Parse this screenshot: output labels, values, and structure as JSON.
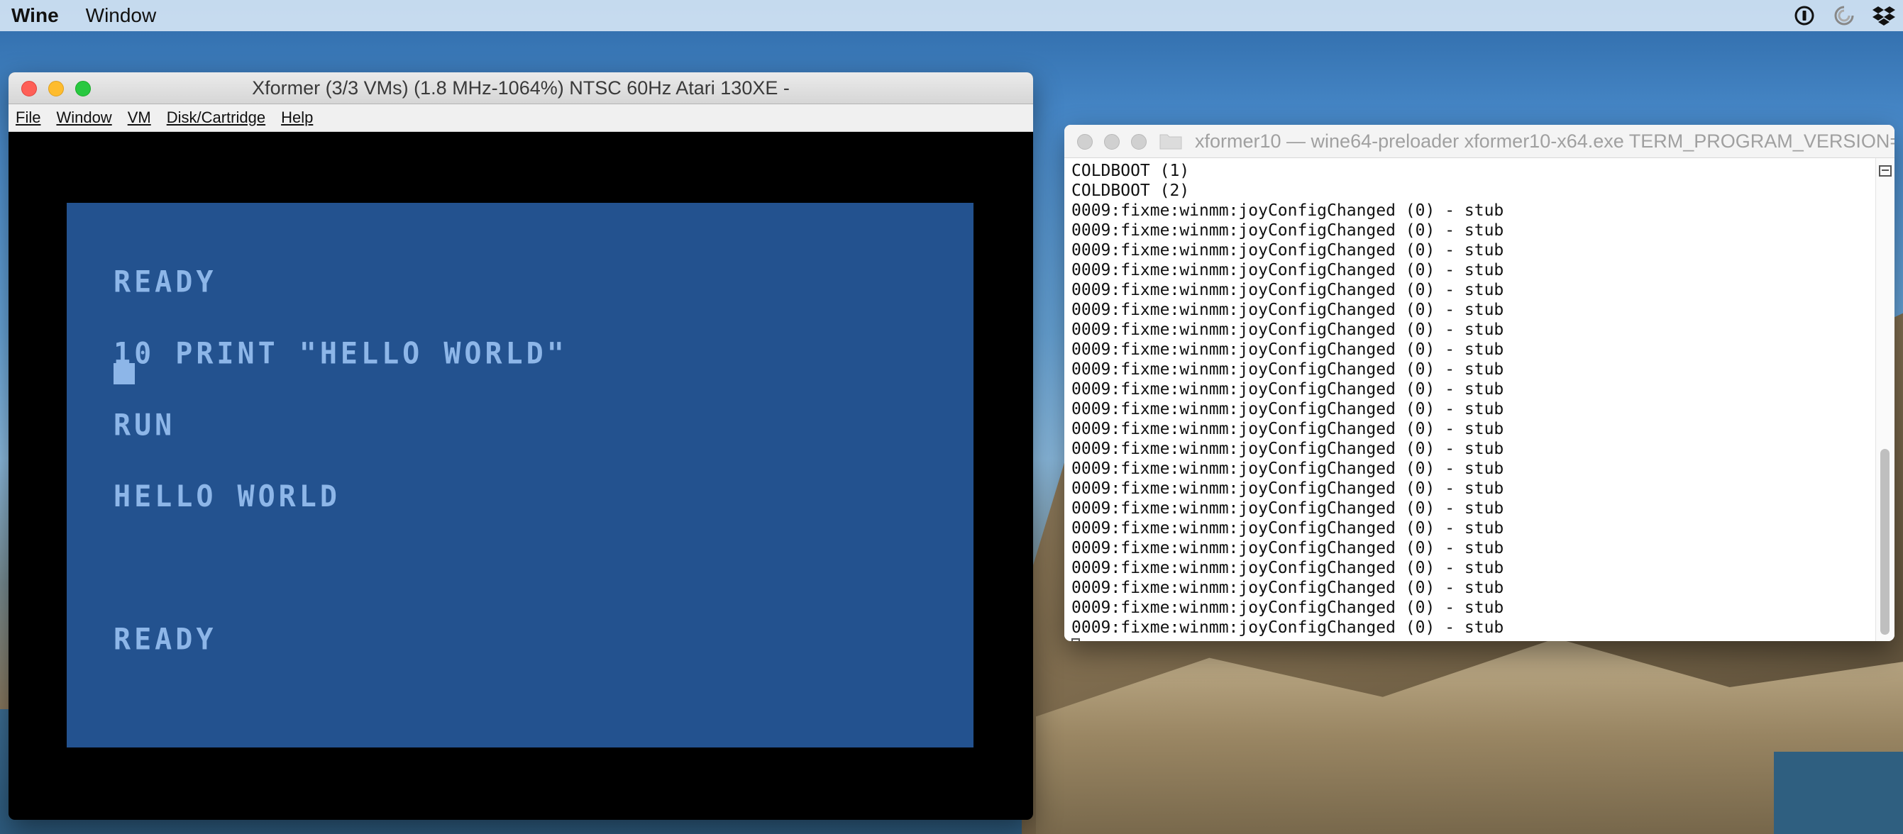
{
  "menubar": {
    "app_name": "Wine",
    "items": [
      "Window"
    ],
    "status_icons": [
      "onepassword-icon",
      "sync-icon",
      "dropbox-icon"
    ]
  },
  "xformer": {
    "title": "Xformer (3/3 VMs) (1.8 MHz-1064%) NTSC 60Hz Atari 130XE -",
    "menu": [
      "File",
      "Window",
      "VM",
      "Disk/Cartridge",
      "Help"
    ],
    "screen": {
      "background": "#23528f",
      "text_color": "#8db6e8",
      "lines": [
        "READY",
        "10 PRINT \"HELLO WORLD\"",
        "RUN",
        "HELLO WORLD",
        "",
        "READY"
      ]
    }
  },
  "terminal": {
    "title": "xformer10 — wine64-preloader xformer10-x64.exe TERM_PROGRAM_VERSION=...",
    "lines": [
      "COLDBOOT (1)",
      "COLDBOOT (2)",
      "0009:fixme:winmm:joyConfigChanged (0) - stub",
      "0009:fixme:winmm:joyConfigChanged (0) - stub",
      "0009:fixme:winmm:joyConfigChanged (0) - stub",
      "0009:fixme:winmm:joyConfigChanged (0) - stub",
      "0009:fixme:winmm:joyConfigChanged (0) - stub",
      "0009:fixme:winmm:joyConfigChanged (0) - stub",
      "0009:fixme:winmm:joyConfigChanged (0) - stub",
      "0009:fixme:winmm:joyConfigChanged (0) - stub",
      "0009:fixme:winmm:joyConfigChanged (0) - stub",
      "0009:fixme:winmm:joyConfigChanged (0) - stub",
      "0009:fixme:winmm:joyConfigChanged (0) - stub",
      "0009:fixme:winmm:joyConfigChanged (0) - stub",
      "0009:fixme:winmm:joyConfigChanged (0) - stub",
      "0009:fixme:winmm:joyConfigChanged (0) - stub",
      "0009:fixme:winmm:joyConfigChanged (0) - stub",
      "0009:fixme:winmm:joyConfigChanged (0) - stub",
      "0009:fixme:winmm:joyConfigChanged (0) - stub",
      "0009:fixme:winmm:joyConfigChanged (0) - stub",
      "0009:fixme:winmm:joyConfigChanged (0) - stub",
      "0009:fixme:winmm:joyConfigChanged (0) - stub",
      "0009:fixme:winmm:joyConfigChanged (0) - stub",
      "0009:fixme:winmm:joyConfigChanged (0) - stub"
    ]
  }
}
